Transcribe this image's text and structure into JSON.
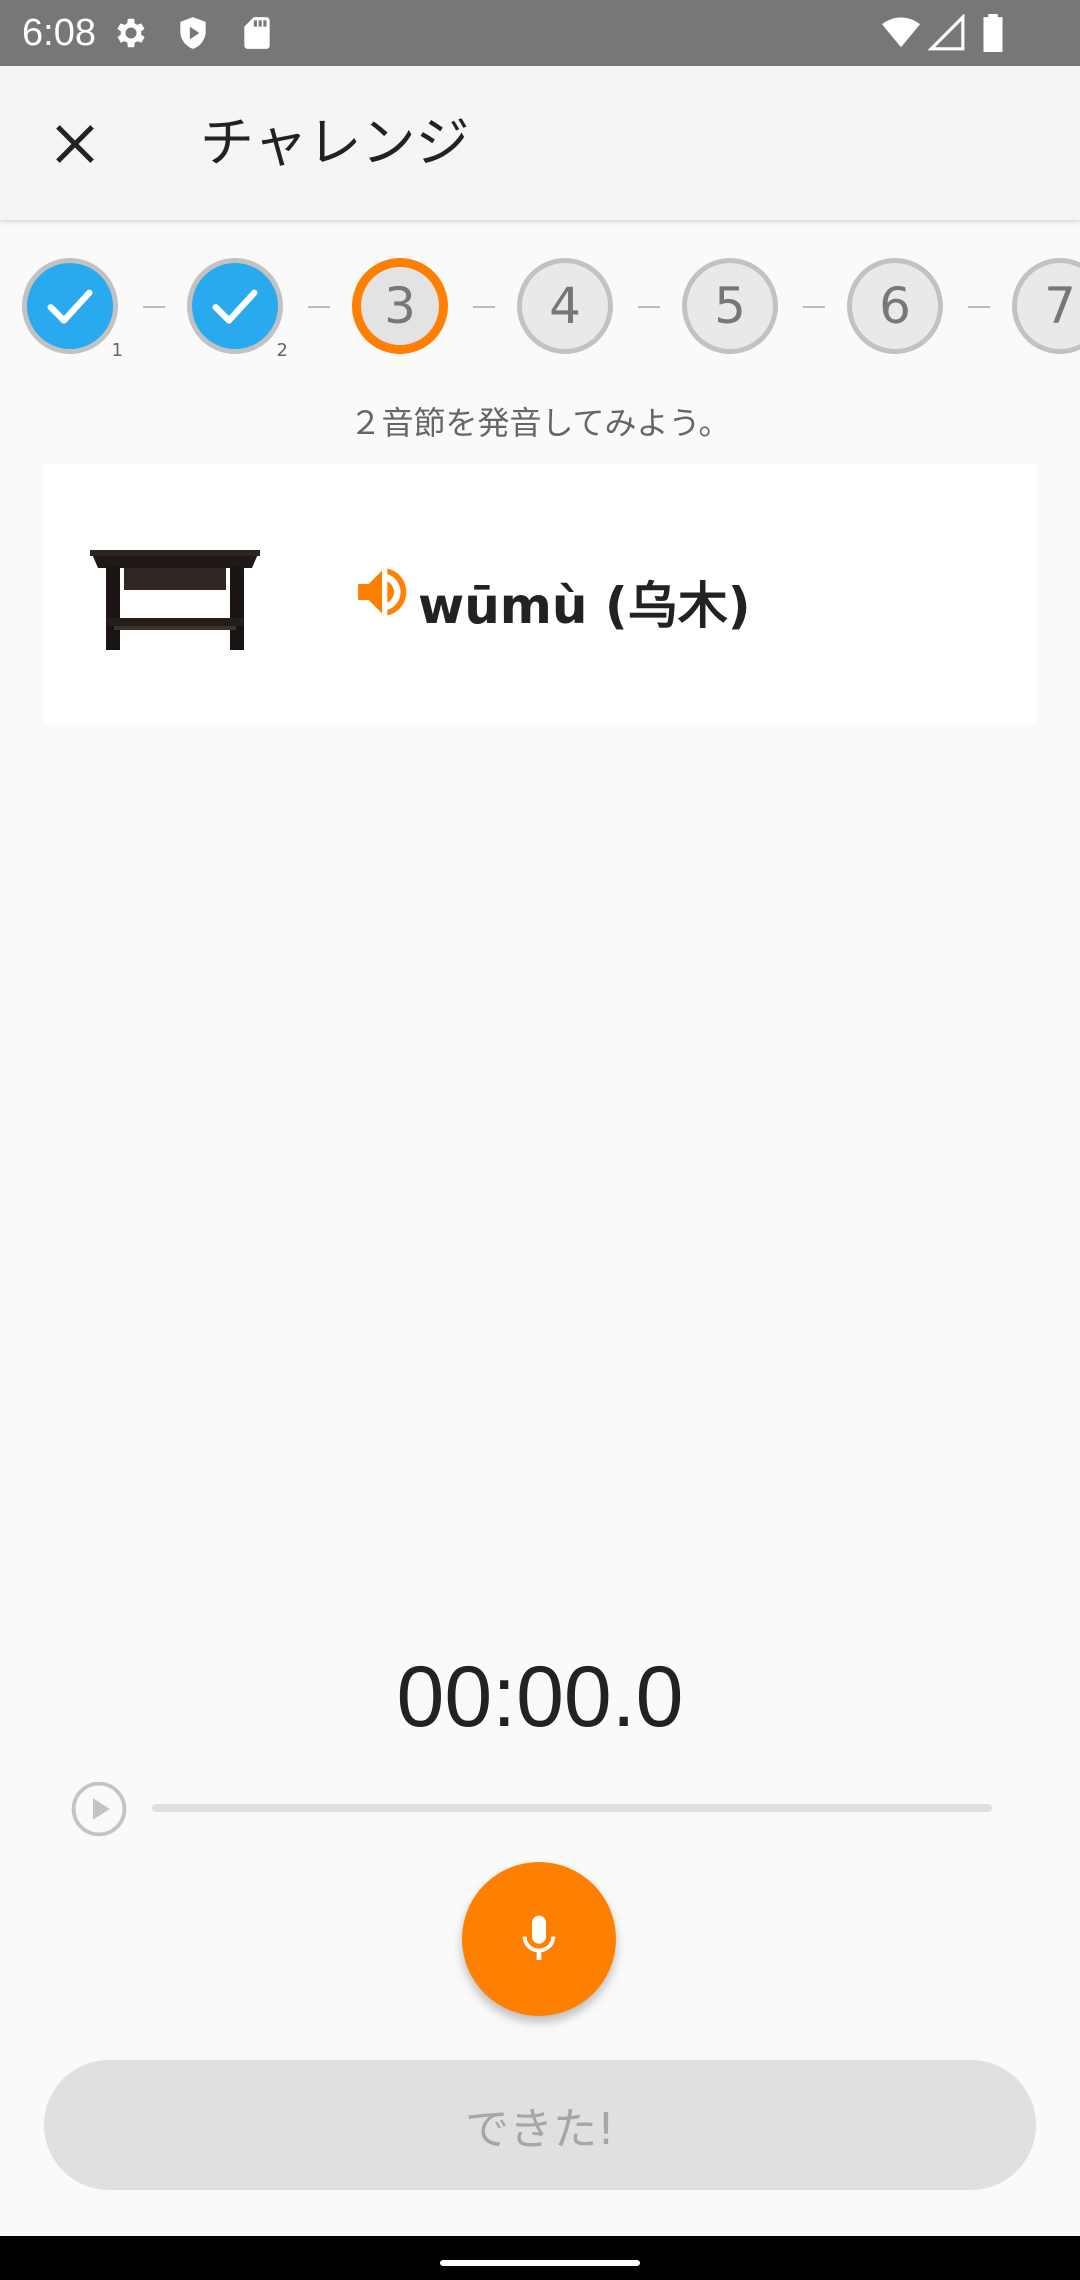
{
  "status_bar": {
    "time": "6:08",
    "left_icons": [
      "gear-icon",
      "shield-icon",
      "sd-card-icon"
    ],
    "right_icons": [
      "wifi-icon",
      "signal-icon",
      "battery-icon"
    ]
  },
  "app_bar": {
    "close_icon": "close-icon",
    "title": "チャレンジ"
  },
  "steps": [
    {
      "label": "",
      "sub": "1",
      "state": "done"
    },
    {
      "label": "",
      "sub": "2",
      "state": "done"
    },
    {
      "label": "3",
      "sub": "",
      "state": "current"
    },
    {
      "label": "4",
      "sub": "",
      "state": "todo"
    },
    {
      "label": "5",
      "sub": "",
      "state": "todo"
    },
    {
      "label": "6",
      "sub": "",
      "state": "todo"
    },
    {
      "label": "7",
      "sub": "",
      "state": "todo"
    }
  ],
  "instruction": "２音節を発音してみよう。",
  "word": {
    "text": "wūmù (乌木)",
    "image": "table-image",
    "speaker_icon": "speaker-icon"
  },
  "recorder": {
    "timer": "00:00.0",
    "progress": 0,
    "play_icon": "play-icon",
    "mic_icon": "microphone-icon"
  },
  "done_button": "できた!",
  "colors": {
    "accent": "#ff8000",
    "done": "#29aaee",
    "status_bar": "#777777"
  }
}
